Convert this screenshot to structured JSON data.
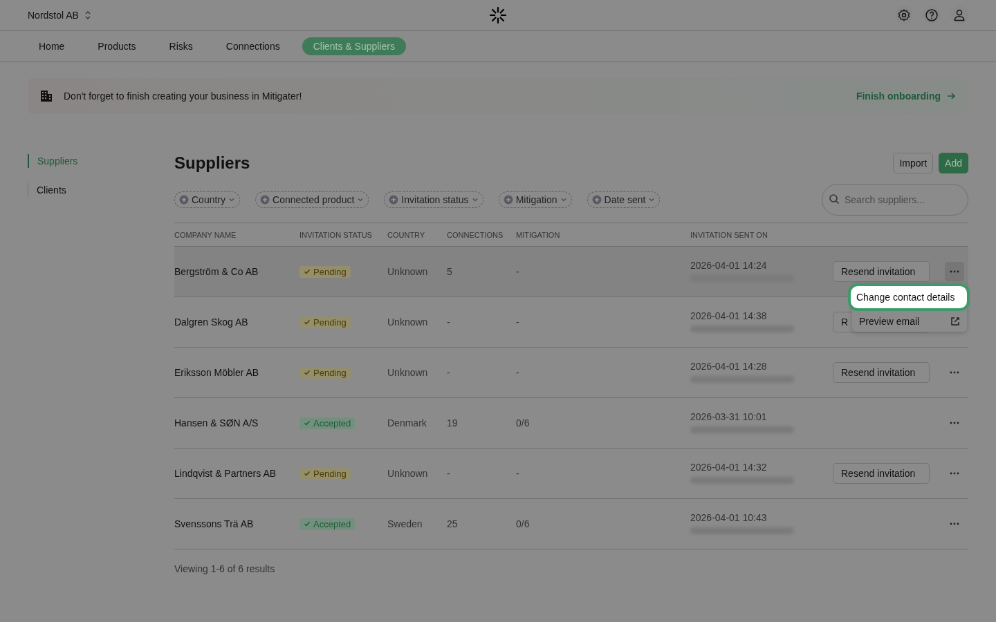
{
  "header": {
    "org": "Nordstol AB"
  },
  "nav": [
    {
      "label": "Home",
      "selected": false
    },
    {
      "label": "Products",
      "selected": false
    },
    {
      "label": "Risks",
      "selected": false
    },
    {
      "label": "Connections",
      "selected": false
    },
    {
      "label": "Clients & Suppliers",
      "selected": true
    }
  ],
  "banner": {
    "message": "Don't forget to finish creating your business in Mitigater!",
    "link": "Finish onboarding"
  },
  "sidebar": {
    "items": [
      {
        "label": "Suppliers",
        "selected": true
      },
      {
        "label": "Clients",
        "selected": false
      }
    ]
  },
  "page": {
    "title": "Suppliers",
    "buttons": [
      "Import",
      "Add"
    ]
  },
  "filters": [
    "Country",
    "Connected product",
    "Invitation status",
    "Mitigation",
    "Date sent"
  ],
  "search": {
    "placeholder": "Search suppliers..."
  },
  "table": {
    "columns": [
      "COMPANY NAME",
      "INVITATION STATUS",
      "COUNTRY",
      "CONNECTIONS",
      "MITIGATION",
      "INVITATION SENT ON"
    ],
    "rows": [
      {
        "company": "Bergström & Co AB",
        "status": {
          "label": "Pending",
          "kind": "pending"
        },
        "country": "Unknown",
        "connections": "5",
        "mitigation": "-",
        "sent": "2026-04-01 14:24",
        "action": "Resend invitation",
        "menu_open": true
      },
      {
        "company": "Dalgren Skog AB",
        "status": {
          "label": "Pending",
          "kind": "pending"
        },
        "country": "Unknown",
        "connections": "-",
        "mitigation": "-",
        "sent": "2026-04-01 14:38",
        "action": "R",
        "menu_open": false
      },
      {
        "company": "Eriksson Möbler AB",
        "status": {
          "label": "Pending",
          "kind": "pending"
        },
        "country": "Unknown",
        "connections": "-",
        "mitigation": "-",
        "sent": "2026-04-01 14:28",
        "action": "Resend invitation",
        "menu_open": false
      },
      {
        "company": "Hansen & SØN A/S",
        "status": {
          "label": "Accepted",
          "kind": "accepted"
        },
        "country": "Denmark",
        "connections": "19",
        "mitigation": "0/6",
        "sent": "2026-03-31 10:01",
        "menu_open": false
      },
      {
        "company": "Lindqvist & Partners AB",
        "status": {
          "label": "Pending",
          "kind": "pending"
        },
        "country": "Unknown",
        "connections": "-",
        "mitigation": "-",
        "sent": "2026-04-01 14:32",
        "action": "Resend invitation",
        "menu_open": false
      },
      {
        "company": "Svenssons Trä AB",
        "status": {
          "label": "Accepted",
          "kind": "accepted"
        },
        "country": "Sweden",
        "connections": "25",
        "mitigation": "0/6",
        "sent": "2026-04-01 10:43",
        "menu_open": false
      }
    ]
  },
  "row_menu": {
    "items": [
      {
        "label": "Change contact details",
        "selected": true
      },
      {
        "label": "Preview email",
        "selected": false
      }
    ]
  },
  "footer": {
    "summary": "Viewing 1-6 of 6 results"
  }
}
